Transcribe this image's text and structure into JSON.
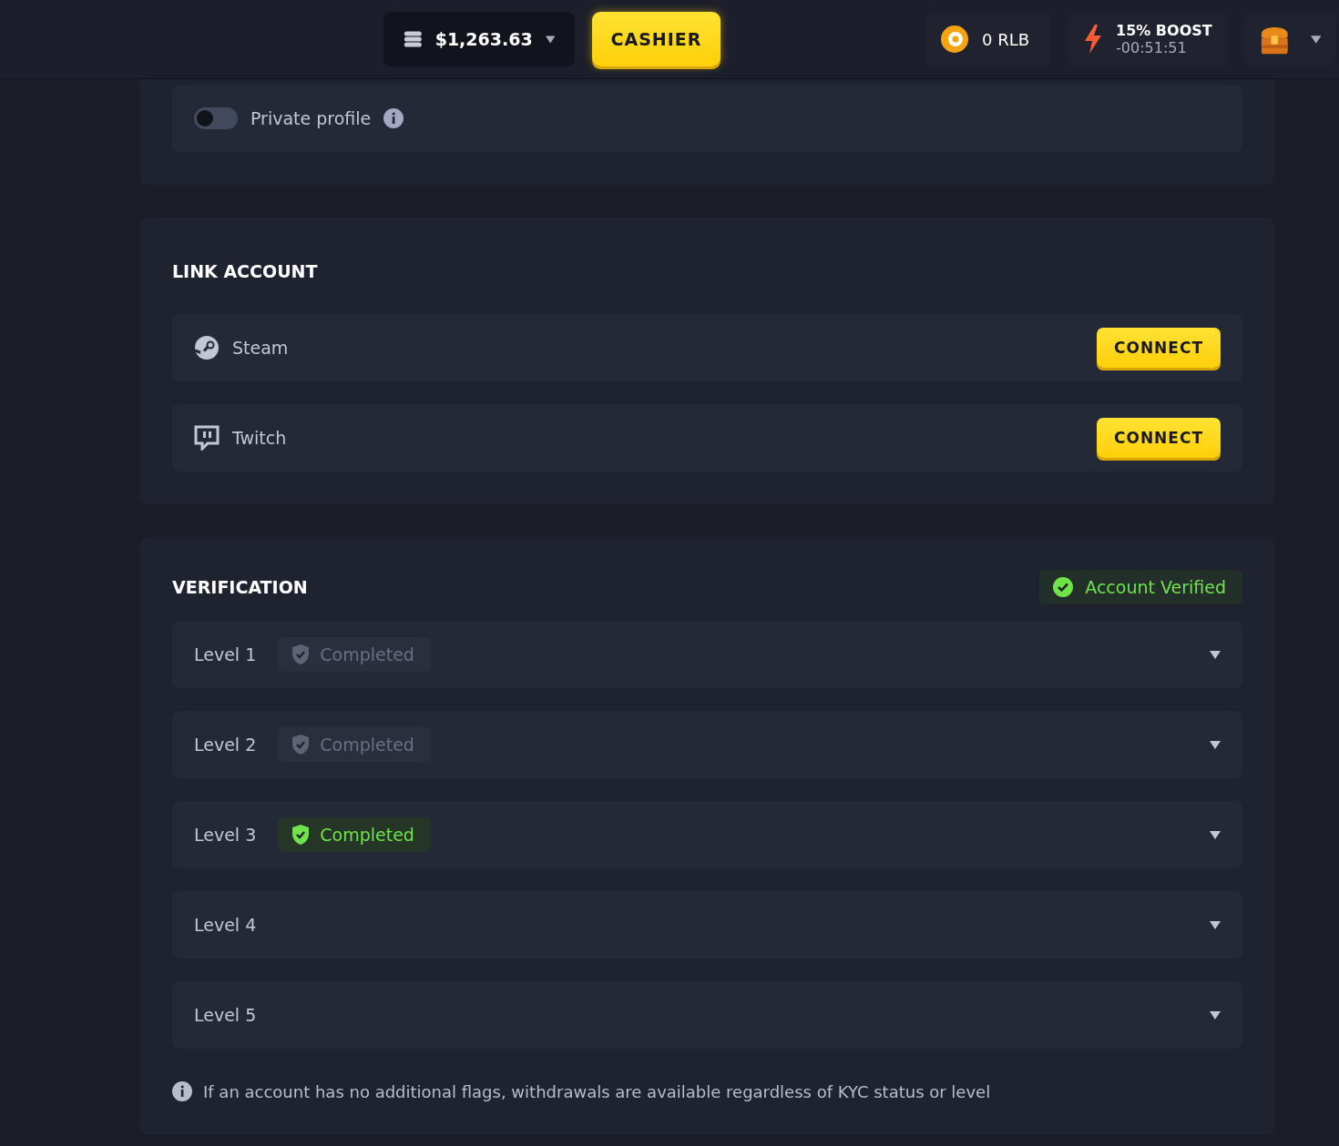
{
  "header": {
    "balance": "$1,263.63",
    "cashier": "CASHIER",
    "rlb": "0 RLB",
    "boost": {
      "title": "15% BOOST",
      "timer": "-00:51:51"
    }
  },
  "privacy": {
    "label": "Private profile",
    "on": false
  },
  "link_account": {
    "title": "LINK ACCOUNT",
    "items": [
      {
        "name": "Steam",
        "kind": "steam",
        "button": "CONNECT"
      },
      {
        "name": "Twitch",
        "kind": "twitch",
        "button": "CONNECT"
      }
    ]
  },
  "verification": {
    "title": "VERIFICATION",
    "status": "Account Verified",
    "levels": [
      {
        "label": "Level 1",
        "badge": {
          "text": "Completed",
          "highlighted": false
        }
      },
      {
        "label": "Level 2",
        "badge": {
          "text": "Completed",
          "highlighted": false
        }
      },
      {
        "label": "Level 3",
        "badge": {
          "text": "Completed",
          "highlighted": true
        }
      },
      {
        "label": "Level 4"
      },
      {
        "label": "Level 5"
      }
    ],
    "note": "If an account has no additional flags, withdrawals are available regardless of KYC status or level"
  }
}
